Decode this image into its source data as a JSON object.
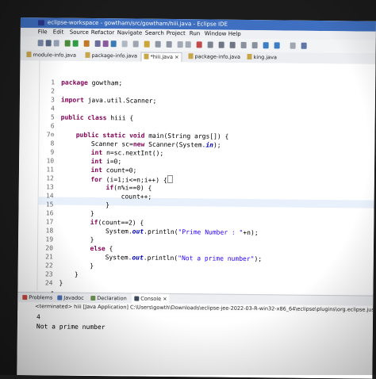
{
  "window": {
    "title": "eclipse-workspace - gowtham/src/gowtham/hiii.java - Eclipse IDE"
  },
  "menu": [
    "File",
    "Edit",
    "Source",
    "Refactor",
    "Navigate",
    "Search",
    "Project",
    "Run",
    "Window",
    "Help"
  ],
  "tabs": [
    {
      "label": "module-info.java",
      "active": false
    },
    {
      "label": "package-info.java",
      "active": false
    },
    {
      "label": "*hiii.java ×",
      "active": true
    },
    {
      "label": "package-info.java",
      "active": false
    },
    {
      "label": "king.java",
      "active": false
    }
  ],
  "code": [
    {
      "n": "1",
      "t": "package gowtham;"
    },
    {
      "n": "2",
      "t": ""
    },
    {
      "n": "3",
      "t": "import java.util.Scanner;"
    },
    {
      "n": "4",
      "t": ""
    },
    {
      "n": "5",
      "t": "public class hiii {"
    },
    {
      "n": "6",
      "t": ""
    },
    {
      "n": "7⊖",
      "t": "    public static void main(String args[]) {"
    },
    {
      "n": "8",
      "t": "        Scanner sc=new Scanner(System.in);"
    },
    {
      "n": "9",
      "t": "        int n=sc.nextInt();"
    },
    {
      "n": "10",
      "t": "        int i=0;"
    },
    {
      "n": "11",
      "t": "        int count=0;"
    },
    {
      "n": "12",
      "t": "        for (i=1;i<=n;i++) {"
    },
    {
      "n": "13",
      "t": "            if(n%i==0) {"
    },
    {
      "n": "14",
      "t": "                count++;"
    },
    {
      "n": "15",
      "t": "            }"
    },
    {
      "n": "16",
      "t": "        }"
    },
    {
      "n": "17",
      "t": "        if(count==2) {"
    },
    {
      "n": "18",
      "t": "            System.out.println(\"Prime Number : \"+n);"
    },
    {
      "n": "19",
      "t": "        }"
    },
    {
      "n": "20",
      "t": "        else {"
    },
    {
      "n": "21",
      "t": "            System.out.println(\"Not a prime number\");"
    },
    {
      "n": "22",
      "t": "        }"
    },
    {
      "n": "23",
      "t": "    }"
    },
    {
      "n": "24",
      "t": "}"
    }
  ],
  "panel_tabs": [
    "Problems",
    "Javadoc",
    "Declaration",
    "Console ×"
  ],
  "console": {
    "status": "<terminated> hiii [Java Application] C:\\Users\\gowth\\Downloads\\eclipse-jee-2022-03-R-win32-x86_64\\eclipse\\plugins\\org.eclipse.justj.openjdk",
    "lines": [
      "4",
      "Not a prime number"
    ]
  },
  "colors": {
    "titlebar": "#3f6fc0",
    "keyword": "#7f0055",
    "string": "#2a00ff",
    "field": "#0000c0"
  }
}
